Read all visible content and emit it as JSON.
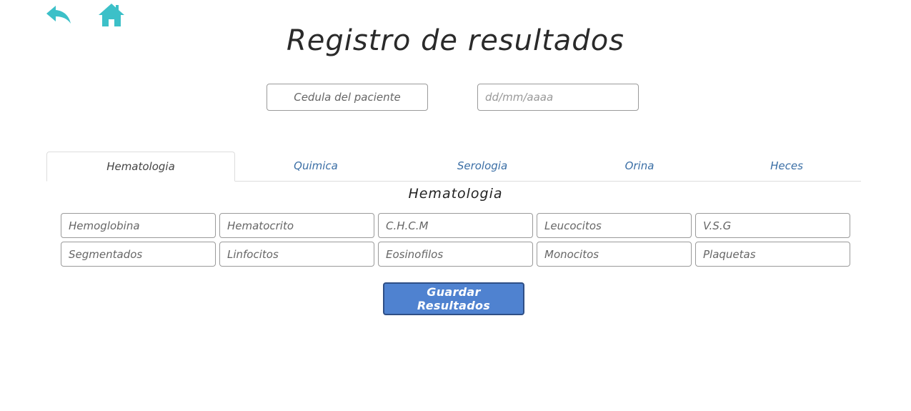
{
  "nav": {
    "back_icon": "reply-arrow-icon",
    "home_icon": "home-icon",
    "icon_color": "#3cc0c8"
  },
  "page": {
    "title": "Registro de resultados"
  },
  "patient": {
    "cedula_placeholder": "Cedula del paciente",
    "fecha_placeholder": "dd/mm/aaaa"
  },
  "tabs": [
    {
      "label": "Hematologia",
      "active": true
    },
    {
      "label": "Quimica",
      "active": false
    },
    {
      "label": "Serologia",
      "active": false
    },
    {
      "label": "Orina",
      "active": false
    },
    {
      "label": "Heces",
      "active": false
    }
  ],
  "section": {
    "title": "Hematologia"
  },
  "fields": [
    {
      "placeholder": "Hemoglobina"
    },
    {
      "placeholder": "Hematocrito"
    },
    {
      "placeholder": "C.H.C.M"
    },
    {
      "placeholder": "Leucocitos"
    },
    {
      "placeholder": "V.S.G"
    },
    {
      "placeholder": "Segmentados"
    },
    {
      "placeholder": "Linfocitos"
    },
    {
      "placeholder": "Eosinofilos"
    },
    {
      "placeholder": "Monocitos"
    },
    {
      "placeholder": "Plaquetas"
    }
  ],
  "actions": {
    "save_label": "Guardar Resultados",
    "save_color": "#4f82d0"
  }
}
